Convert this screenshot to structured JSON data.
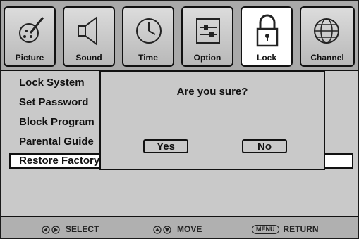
{
  "tabs": [
    {
      "label": "Picture",
      "icon": "picture-icon",
      "active": false
    },
    {
      "label": "Sound",
      "icon": "sound-icon",
      "active": false
    },
    {
      "label": "Time",
      "icon": "clock-icon",
      "active": false
    },
    {
      "label": "Option",
      "icon": "option-icon",
      "active": false
    },
    {
      "label": "Lock",
      "icon": "padlock-icon",
      "active": true
    },
    {
      "label": "Channel",
      "icon": "globe-icon",
      "active": false
    }
  ],
  "menu": {
    "items": [
      "Lock System",
      "Set Password",
      "Block Program",
      "Parental Guide",
      "Restore Factory Default"
    ]
  },
  "dialog": {
    "message": "Are you sure?",
    "yes_label": "Yes",
    "no_label": "No"
  },
  "hints": {
    "select": "SELECT",
    "move": "MOVE",
    "menu_key": "MENU",
    "return": "RETURN"
  }
}
